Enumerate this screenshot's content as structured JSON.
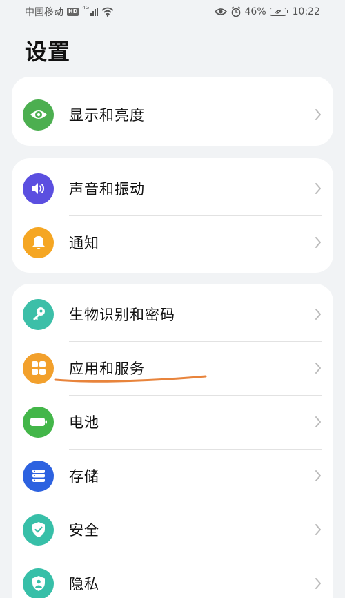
{
  "status_bar": {
    "carrier": "中国移动",
    "hd": "HD",
    "network": "4G",
    "battery": "46%",
    "time": "10:22"
  },
  "title": "设置",
  "cards": [
    {
      "items": [
        {
          "label": "显示和亮度",
          "icon": "eye-icon",
          "color": "#4caf50"
        }
      ]
    },
    {
      "items": [
        {
          "label": "声音和振动",
          "icon": "speaker-icon",
          "color": "#5b4fe0"
        },
        {
          "label": "通知",
          "icon": "bell-icon",
          "color": "#f5a623"
        }
      ]
    },
    {
      "items": [
        {
          "label": "生物识别和密码",
          "icon": "key-icon",
          "color": "#3cbfa8"
        },
        {
          "label": "应用和服务",
          "icon": "apps-icon",
          "color": "#f2a02c"
        },
        {
          "label": "电池",
          "icon": "battery-icon",
          "color": "#43b649"
        },
        {
          "label": "存储",
          "icon": "storage-icon",
          "color": "#2d62e0"
        },
        {
          "label": "安全",
          "icon": "shield-check-icon",
          "color": "#37bfa8"
        },
        {
          "label": "隐私",
          "icon": "privacy-icon",
          "color": "#37bfa8"
        }
      ]
    }
  ],
  "annotation_color": "#e8843c"
}
